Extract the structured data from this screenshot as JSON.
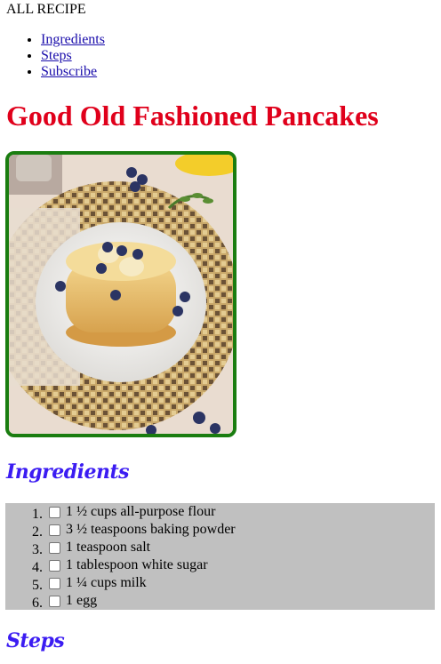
{
  "header": {
    "brand": "ALL RECIPE",
    "nav": [
      {
        "label": "Ingredients"
      },
      {
        "label": "Steps"
      },
      {
        "label": "Subscribe"
      }
    ]
  },
  "recipe": {
    "title": "Good Old Fashioned Pancakes",
    "image_alt": "Stack of pancakes topped with blueberries and banana slices on a white plate",
    "ingredients_heading": "Ingredients",
    "ingredients": [
      {
        "text": "1 ½ cups all-purpose flour",
        "checked": false
      },
      {
        "text": "3 ½ teaspoons baking powder",
        "checked": false
      },
      {
        "text": "1 teaspoon salt",
        "checked": false
      },
      {
        "text": "1 tablespoon white sugar",
        "checked": false
      },
      {
        "text": "1 ¼ cups milk",
        "checked": false
      },
      {
        "text": "1 egg",
        "checked": false
      }
    ],
    "steps_heading": "Steps"
  },
  "colors": {
    "title": "#e0001b",
    "heading": "#3b1cf2",
    "image_border": "#1a7d10",
    "ingredients_bg": "#c0c0c0",
    "link": "#1a0dab"
  }
}
